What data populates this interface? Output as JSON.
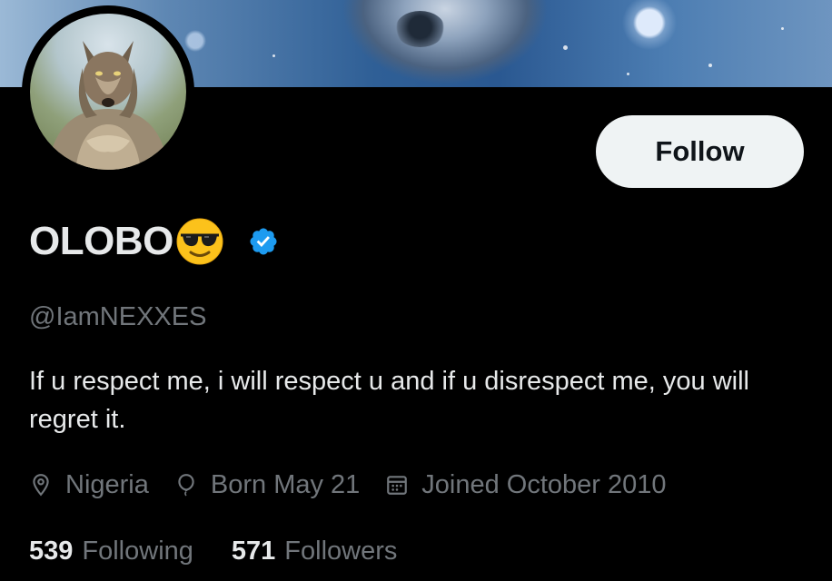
{
  "profile": {
    "display_name": "OLOBO",
    "name_emoji": "smiling-face-with-sunglasses",
    "verified": true,
    "handle": "@IamNEXXES",
    "bio": "If u respect me, i will respect u and if u disrespect me, you will regret it.",
    "location": "Nigeria",
    "birthday": "Born May 21",
    "joined": "Joined October 2010"
  },
  "actions": {
    "follow_label": "Follow"
  },
  "stats": {
    "following_count": "539",
    "following_label": "Following",
    "followers_count": "571",
    "followers_label": "Followers"
  },
  "icons": {
    "location": "location-pin-icon",
    "birthday": "balloon-icon",
    "joined": "calendar-icon",
    "verified": "verified-badge-icon"
  },
  "colors": {
    "background": "#000000",
    "primary_text": "#e7e9ea",
    "secondary_text": "#71767b",
    "verified_blue": "#1d9bf0",
    "follow_button_bg": "#eff3f4"
  }
}
